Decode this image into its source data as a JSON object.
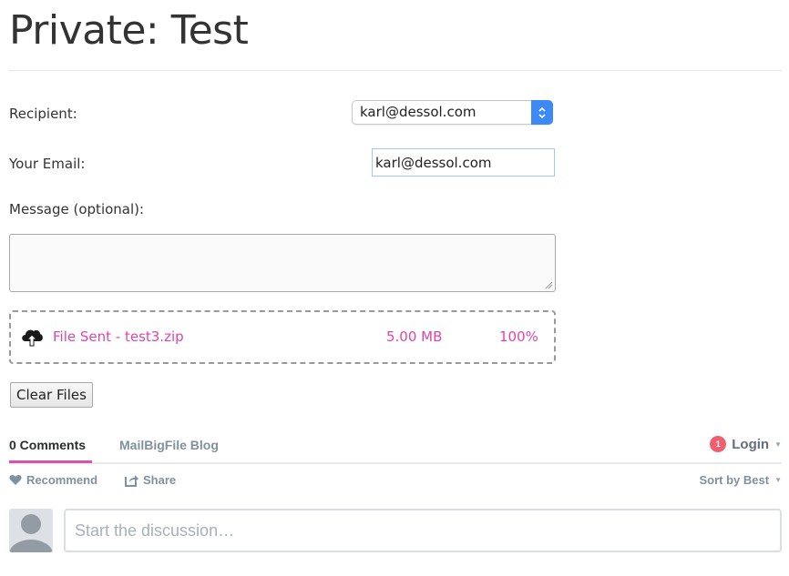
{
  "page": {
    "title": "Private: Test"
  },
  "form": {
    "recipient_label": "Recipient:",
    "recipient_value": "karl@dessol.com",
    "email_label": "Your Email:",
    "email_value": "karl@dessol.com",
    "message_label": "Message (optional):",
    "message_value": ""
  },
  "file": {
    "icon": "cloud-upload-icon",
    "status_name": "File Sent - test3.zip",
    "size": "5.00 MB",
    "progress": "100%",
    "accent_color": "#e044a8"
  },
  "actions": {
    "clear_files_label": "Clear Files"
  },
  "comments": {
    "tabs": [
      {
        "label": "0 Comments",
        "active": true
      },
      {
        "label": "MailBigFile Blog",
        "active": false
      }
    ],
    "notification_count": "1",
    "login_label": "Login",
    "recommend_label": "Recommend",
    "share_label": "Share",
    "sort_label": "Sort by Best",
    "input_placeholder": "Start the discussion…",
    "accent_color": "#e04fa9",
    "badge_color": "#f05f70"
  }
}
